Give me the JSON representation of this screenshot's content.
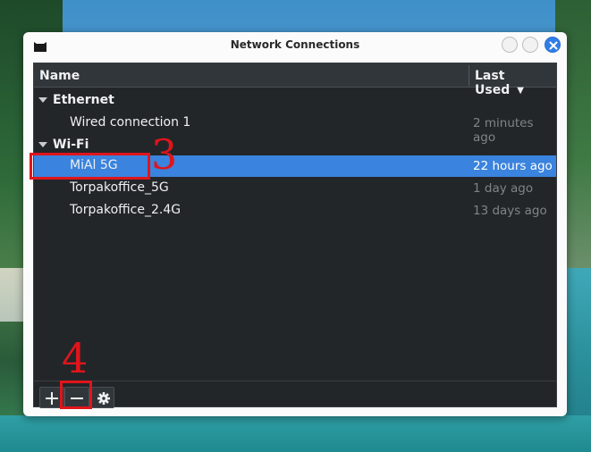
{
  "window": {
    "title": "Network Connections"
  },
  "columns": {
    "name": "Name",
    "last_used": "Last Used"
  },
  "groups": [
    {
      "label": "Ethernet",
      "items": [
        {
          "name": "Wired connection 1",
          "time": "2 minutes ago"
        }
      ]
    },
    {
      "label": "Wi-Fi",
      "items": [
        {
          "name": "MiAl 5G",
          "time": "22 hours ago",
          "selected": true
        },
        {
          "name": "Torpakoffice_5G",
          "time": "1 day ago"
        },
        {
          "name": "Torpakoffice_2.4G",
          "time": "13 days ago"
        }
      ]
    }
  ],
  "annotations": {
    "step3": "3",
    "step4": "4"
  },
  "icons": {
    "app": "app-icon",
    "minimize": "minimize-icon",
    "maximize": "maximize-icon",
    "close": "close-icon",
    "expand": "triangle-down-icon",
    "sort": "sort-down-icon",
    "add": "plus-icon",
    "remove": "minus-icon",
    "settings": "gear-icon"
  },
  "colors": {
    "accent": "#3a83de",
    "annotation": "#e0151b",
    "panel": "#232629"
  }
}
